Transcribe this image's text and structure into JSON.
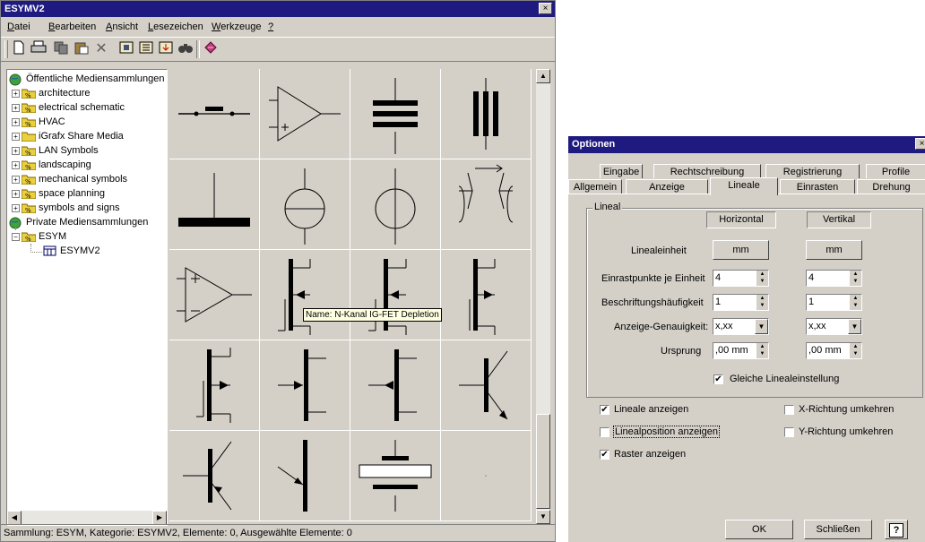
{
  "main_window": {
    "title": "ESYMV2",
    "close_glyph": "×",
    "menu": [
      {
        "hot": "D",
        "rest": "atei"
      },
      {
        "hot": "B",
        "rest": "earbeiten"
      },
      {
        "hot": "A",
        "rest": "nsicht"
      },
      {
        "hot": "L",
        "rest": "esezeichen"
      },
      {
        "hot": "W",
        "rest": "erkzeuge"
      },
      {
        "hot": "?",
        "rest": ""
      }
    ],
    "toolbar_icons": [
      "new-icon",
      "print-icon",
      "copy-icon",
      "paste-icon",
      "delete-icon",
      "catalog-icon",
      "catalog-open-icon",
      "catalog-export-icon",
      "find-icon",
      "bookmark-icon"
    ],
    "tree": {
      "public_root": "Öffentliche Mediensammlungen",
      "public_items": [
        "architecture",
        "electrical schematic",
        "HVAC",
        "iGrafx Share Media",
        "LAN Symbols",
        "landscaping",
        "mechanical symbols",
        "space planning",
        "symbols and signs"
      ],
      "private_root": "Private Mediensammlungen",
      "esym": "ESYM",
      "esymv2": "ESYMV2"
    },
    "symbols": [
      "push-button-symbol",
      "opamp-symbol",
      "capacitor-symbol",
      "triple-bar-symbol",
      "ground-plate-symbol",
      "current-source-symbol",
      "voltage-source-symbol",
      "optocoupler-symbol",
      "opamp-plus-minus-symbol",
      "nfet-depletion-symbol",
      "nfet-depletion-2-symbol",
      "pfet-symbol",
      "mosfet-4-symbol",
      "jfet-n-symbol",
      "jfet-p-symbol",
      "npn-transistor-symbol",
      "pnp-transistor-symbol",
      "transistor-emitter-symbol",
      "battery-symbol",
      "empty-symbol"
    ],
    "tooltip": "Name: N-Kanal IG-FET Depletion",
    "status": "Sammlung: ESYM, Kategorie: ESYMV2, Elemente: 0, Ausgewählte Elemente: 0"
  },
  "options_dialog": {
    "title": "Optionen",
    "close_glyph": "×",
    "tabs_back": [
      "Eingabe",
      "Rechtschreibung",
      "Registrierung",
      "Profile"
    ],
    "tabs_front": [
      "Allgemein",
      "Anzeige",
      "Lineale",
      "Einrasten",
      "Drehung"
    ],
    "active_tab": "Lineale",
    "group_title": "Lineal",
    "col_horizontal": "Horizontal",
    "col_vertical": "Vertikal",
    "rows": {
      "einheit": {
        "label": "Linealeinheit",
        "hot": "h",
        "h": "mm",
        "v": "mm"
      },
      "einrast": {
        "label": "Einrastpunkte je Einheit",
        "hot": "E",
        "h": "4",
        "v": "4"
      },
      "beschr": {
        "label": "Beschriftungshäufigkeit",
        "hot": "B",
        "h": "1",
        "v": "1"
      },
      "genau": {
        "label": "Anzeige-Genauigkeit:",
        "hot": "z",
        "h": "x,xx",
        "v": "x,xx"
      },
      "ursprung": {
        "label": "Ursprung",
        "hot": "U",
        "h": ",00 mm",
        "v": ",00 mm"
      }
    },
    "gleiche": {
      "label": "Gleiche Linealeinstellung",
      "checked": true
    },
    "checks": {
      "lineale_anzeigen": {
        "label": "Lineale anzeigen",
        "checked": true
      },
      "linealposition": {
        "label": "Linealposition anzeigen",
        "checked": false
      },
      "raster": {
        "label": "Raster anzeigen",
        "checked": true
      },
      "x_umkehren": {
        "label": "X-Richtung umkehren",
        "checked": false
      },
      "y_umkehren": {
        "label": "Y-Richtung umkehren",
        "checked": false
      }
    },
    "ok_label": "OK",
    "close_label": "Schließen",
    "help_label": "?"
  }
}
